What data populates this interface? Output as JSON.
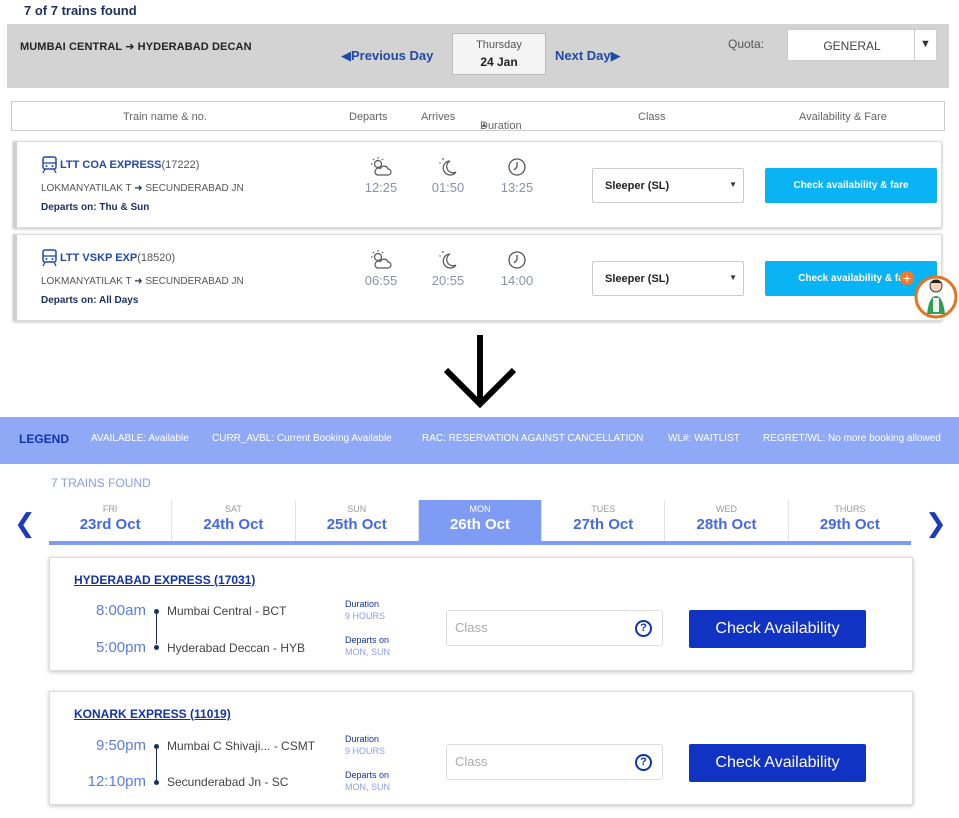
{
  "old": {
    "count_text": "7 of 7 trains found",
    "route_from": "MUMBAI CENTRAL",
    "route_to": "HYDERABAD DECAN",
    "prev_day": "Previous Day",
    "next_day": "Next Day",
    "date_weekday": "Thursday",
    "date_day": "24 Jan",
    "quota_label": "Quota:",
    "quota_value": "GENERAL",
    "columns": {
      "train": "Train name & no.",
      "departs": "Departs",
      "arrives": "Arrives",
      "duration": "Duration",
      "class": "Class",
      "availability": "Availability & Fare"
    },
    "trains": [
      {
        "name": "LTT COA EXPRESS",
        "number": "(17222)",
        "from": "LOKMANYATILAK T",
        "to": "SECUNDERABAD JN",
        "departs_on": "Departs on: Thu & Sun",
        "depart_time": "12:25",
        "arrive_time": "01:50",
        "duration": "13:25",
        "class": "Sleeper (SL)",
        "button": "Check availability & fare"
      },
      {
        "name": "LTT VSKP EXP",
        "number": "(18520)",
        "from": "LOKMANYATILAK T",
        "to": "SECUNDERABAD JN",
        "departs_on": "Departs on: All Days",
        "depart_time": "06:55",
        "arrive_time": "20:55",
        "duration": "14:00",
        "class": "Sleeper (SL)",
        "button": "Check availability & fa"
      }
    ]
  },
  "legend": {
    "title": "LEGEND",
    "items": [
      "AVAILABLE: Available",
      "CURR_AVBL: Current Booking Available",
      "RAC: RESERVATION AGAINST CANCELLATION",
      "WL#: WAITLIST",
      "REGRET/WL: No more booking allowed"
    ]
  },
  "new": {
    "count_text": "7 TRAINS FOUND",
    "dates": [
      {
        "dow": "FRI",
        "date": "23rd Oct"
      },
      {
        "dow": "SAT",
        "date": "24th Oct"
      },
      {
        "dow": "SUN",
        "date": "25th Oct"
      },
      {
        "dow": "MON",
        "date": "26th Oct"
      },
      {
        "dow": "TUES",
        "date": "27th Oct"
      },
      {
        "dow": "WED",
        "date": "28th Oct"
      },
      {
        "dow": "THURS",
        "date": "29th Oct"
      }
    ],
    "active_date_index": 3,
    "trains": [
      {
        "name": "HYDERABAD EXPRESS (17031)",
        "dep_time": "8:00am",
        "dep_station": "Mumbai Central - BCT",
        "arr_time": "5:00pm",
        "arr_station": "Hyderabad Deccan - HYB",
        "duration_label": "Duration",
        "duration": "9 HOURS",
        "departs_label": "Departs on",
        "departs_days": "MON, SUN",
        "class_placeholder": "Class",
        "button": "Check Availability"
      },
      {
        "name": "KONARK EXPRESS (11019)",
        "dep_time": "9:50pm",
        "dep_station": "Mumbai C Shivaji... - CSMT",
        "arr_time": "12:10pm",
        "arr_station": "Secunderabad Jn - SC",
        "duration_label": "Duration",
        "duration": "9 HOURS",
        "departs_label": "Departs on",
        "departs_days": "MON, SUN",
        "class_placeholder": "Class",
        "button": "Check Availability"
      }
    ]
  },
  "colors": {
    "old_blue": "#1f4aa8",
    "old_button": "#0ab3f4",
    "legend_bg": "#8fa9f6",
    "new_primary": "#1133c4",
    "new_accent": "#7f9cf5"
  }
}
